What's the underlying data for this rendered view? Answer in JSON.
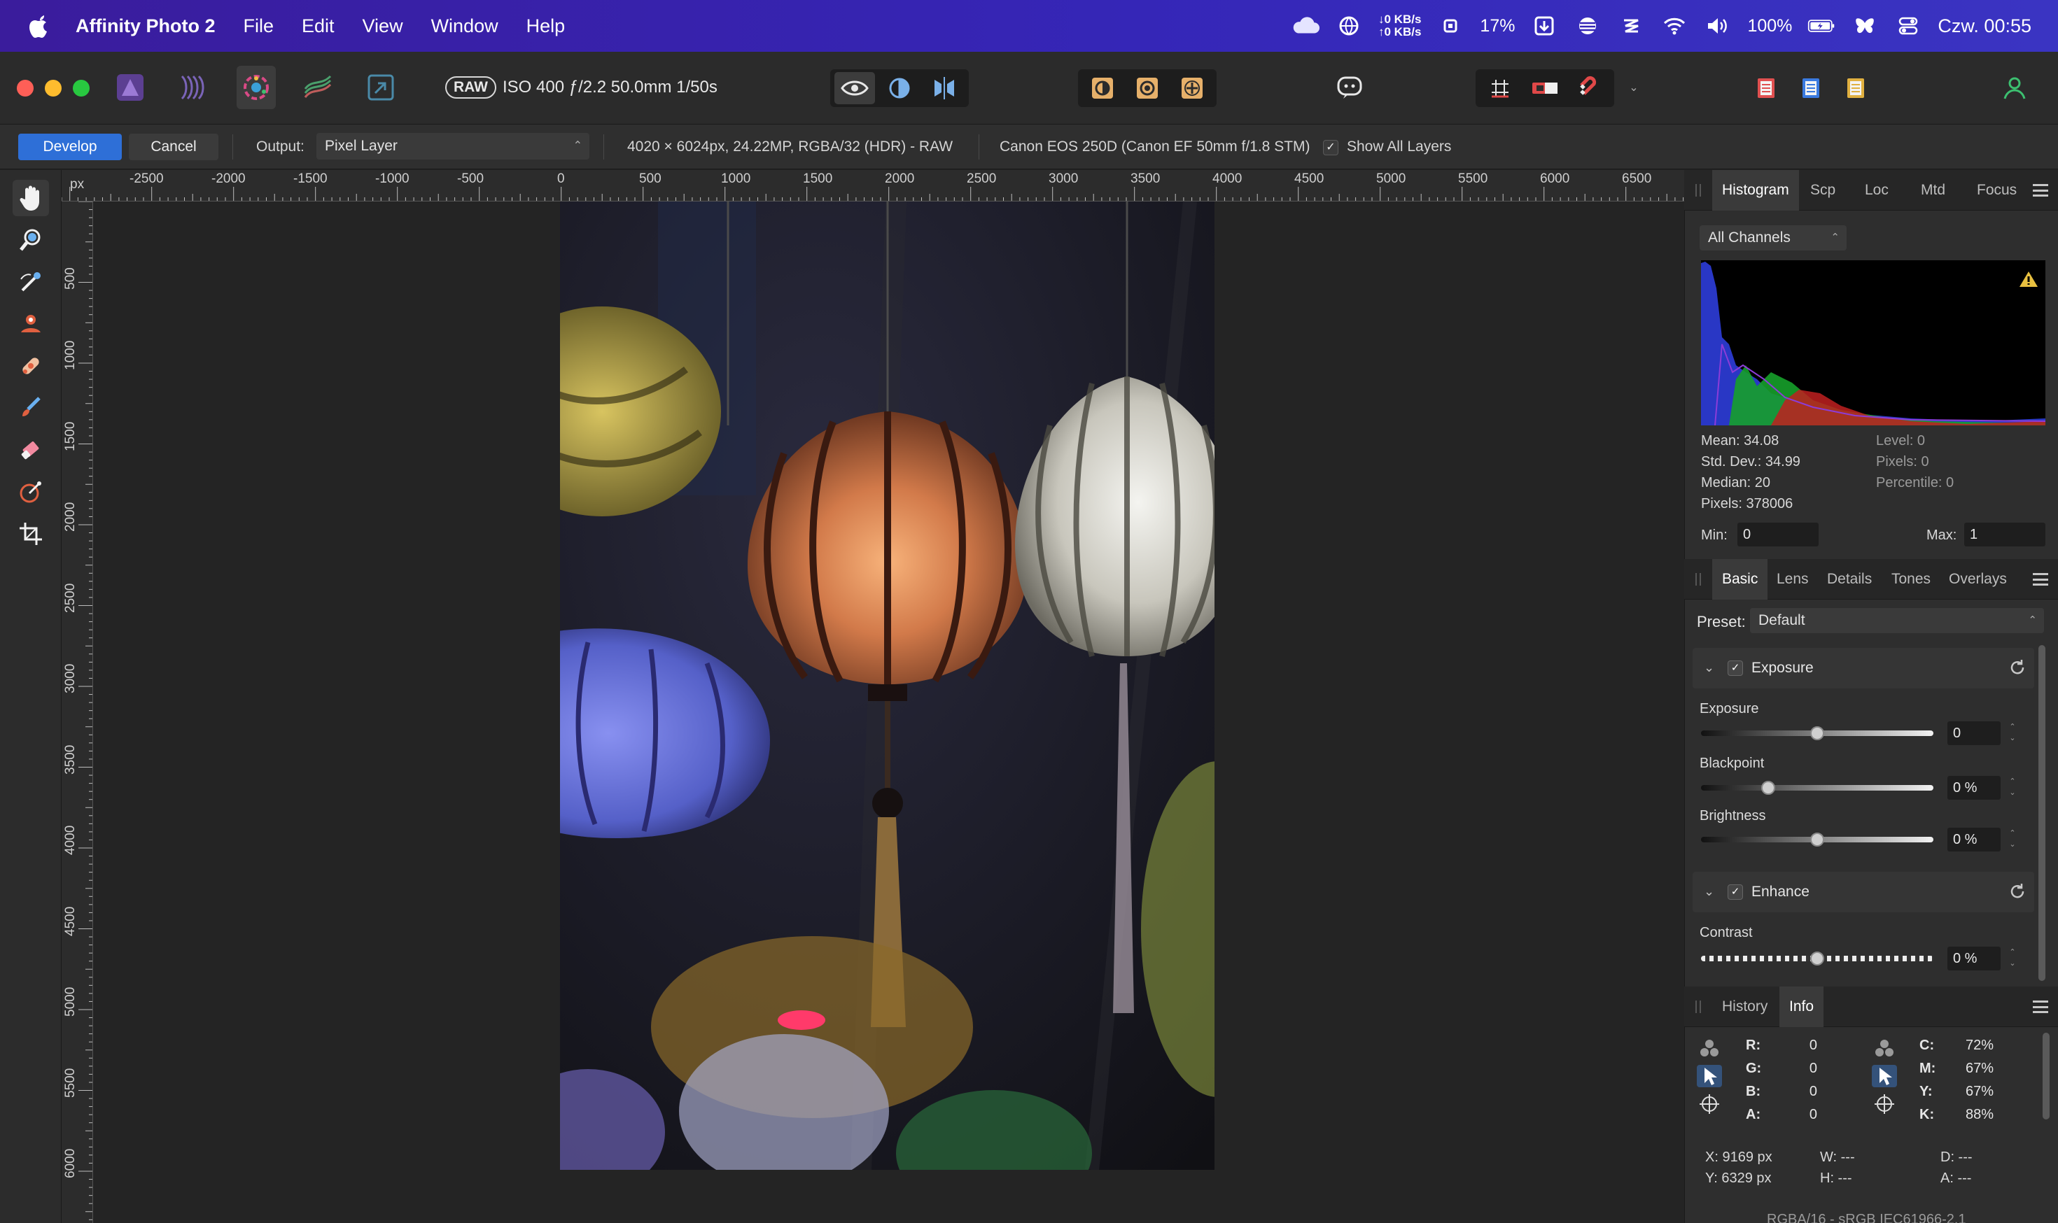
{
  "menubar": {
    "app_name": "Affinity Photo 2",
    "menus": [
      "File",
      "Edit",
      "View",
      "Window",
      "Help"
    ],
    "net_down": "↓0 KB/s",
    "net_up": "↑0 KB/s",
    "cpu": "17%",
    "battery": "100%",
    "clock": "Czw. 00:55"
  },
  "toolbar": {
    "raw_badge": "RAW",
    "exif": "ISO 400 ƒ/2.2 50.0mm 1/50s"
  },
  "context": {
    "develop": "Develop",
    "cancel": "Cancel",
    "output_label": "Output:",
    "output_value": "Pixel Layer",
    "image_info": "4020 × 6024px, 24.22MP, RGBA/32 (HDR) - RAW",
    "camera": "Canon EOS 250D (Canon EF 50mm f/1.8 STM)",
    "show_layers": "Show All Layers",
    "show_layers_checked": true
  },
  "ruler": {
    "unit": "px",
    "h_labels": [
      "-2500",
      "-2000",
      "-1500",
      "-1000",
      "-500",
      "0",
      "500",
      "1000",
      "1500",
      "2000",
      "2500",
      "3000",
      "3500",
      "4000",
      "4500",
      "5000",
      "5500",
      "6000",
      "6500"
    ],
    "v_labels": [
      "500",
      "1000",
      "1500",
      "2000",
      "2500",
      "3000",
      "3500",
      "4000",
      "4500",
      "5000",
      "5500",
      "6000"
    ]
  },
  "histogram_panel": {
    "tabs": [
      "Histogram",
      "Scp",
      "Loc",
      "Mtd",
      "Focus"
    ],
    "active_tab": "Histogram",
    "channel": "All Channels",
    "mean": "Mean: 34.08",
    "std_dev": "Std. Dev.: 34.99",
    "median": "Median: 20",
    "pixels": "Pixels: 378006",
    "level": "Level: 0",
    "pixels_sel": "Pixels: 0",
    "percentile": "Percentile: 0",
    "min_label": "Min:",
    "min_value": "0",
    "max_label": "Max:",
    "max_value": "1"
  },
  "develop_panel": {
    "tabs": [
      "Basic",
      "Lens",
      "Details",
      "Tones",
      "Overlays"
    ],
    "active_tab": "Basic",
    "preset_label": "Preset:",
    "preset_value": "Default",
    "sections": [
      {
        "title": "Exposure",
        "enabled": true,
        "sliders": [
          {
            "label": "Exposure",
            "value": "0",
            "level": 0.5
          },
          {
            "label": "Blackpoint",
            "value": "0 %",
            "level": 0.29
          },
          {
            "label": "Brightness",
            "value": "0 %",
            "level": 0.5
          }
        ]
      },
      {
        "title": "Enhance",
        "enabled": true,
        "sliders": [
          {
            "label": "Contrast",
            "value": "0 %",
            "level": 0.5
          }
        ]
      }
    ]
  },
  "info_panel": {
    "tabs": [
      "History",
      "Info"
    ],
    "active_tab": "Info",
    "rgba": [
      {
        "label": "R:",
        "value": "0"
      },
      {
        "label": "G:",
        "value": "0"
      },
      {
        "label": "B:",
        "value": "0"
      },
      {
        "label": "A:",
        "value": "0"
      }
    ],
    "cmyk": [
      {
        "label": "C:",
        "value": "72%"
      },
      {
        "label": "M:",
        "value": "67%"
      },
      {
        "label": "Y:",
        "value": "67%"
      },
      {
        "label": "K:",
        "value": "88%"
      }
    ],
    "x": "X: 9169 px",
    "y": "Y: 6329 px",
    "w": "W: ---",
    "h": "H: ---",
    "d": "D: ---",
    "a": "A: ---",
    "profile": "RGBA/16 - sRGB IEC61966-2.1"
  },
  "colors": {
    "accent": "#2e6fd7",
    "menubar": "#3526b7"
  }
}
